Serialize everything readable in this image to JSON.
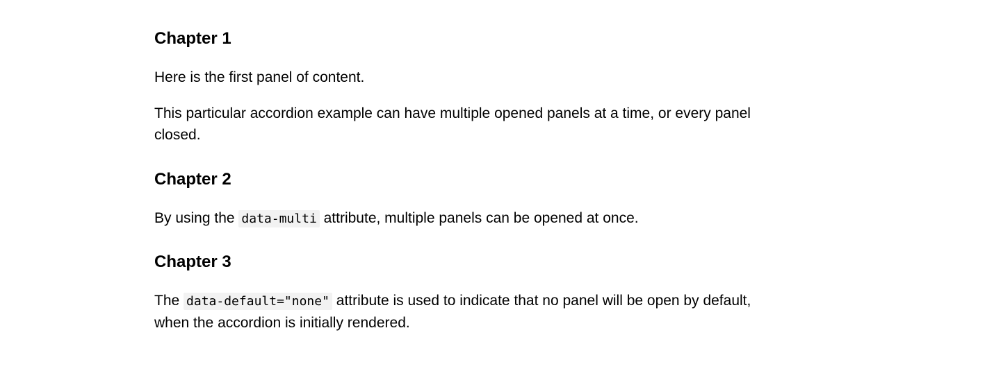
{
  "chapters": [
    {
      "title": "Chapter 1",
      "paragraphs": [
        {
          "segments": [
            {
              "type": "text",
              "value": "Here is the first panel of content."
            }
          ]
        },
        {
          "segments": [
            {
              "type": "text",
              "value": "This particular accordion example can have multiple opened panels at a time, or every panel closed."
            }
          ]
        }
      ]
    },
    {
      "title": "Chapter 2",
      "paragraphs": [
        {
          "segments": [
            {
              "type": "text",
              "value": "By using the "
            },
            {
              "type": "code",
              "value": "data-multi"
            },
            {
              "type": "text",
              "value": " attribute, multiple panels can be opened at once."
            }
          ]
        }
      ]
    },
    {
      "title": "Chapter 3",
      "paragraphs": [
        {
          "segments": [
            {
              "type": "text",
              "value": "The "
            },
            {
              "type": "code",
              "value": "data-default=\"none\""
            },
            {
              "type": "text",
              "value": " attribute is used to indicate that no panel will be open by default, when the accordion is initially rendered."
            }
          ]
        }
      ]
    }
  ]
}
